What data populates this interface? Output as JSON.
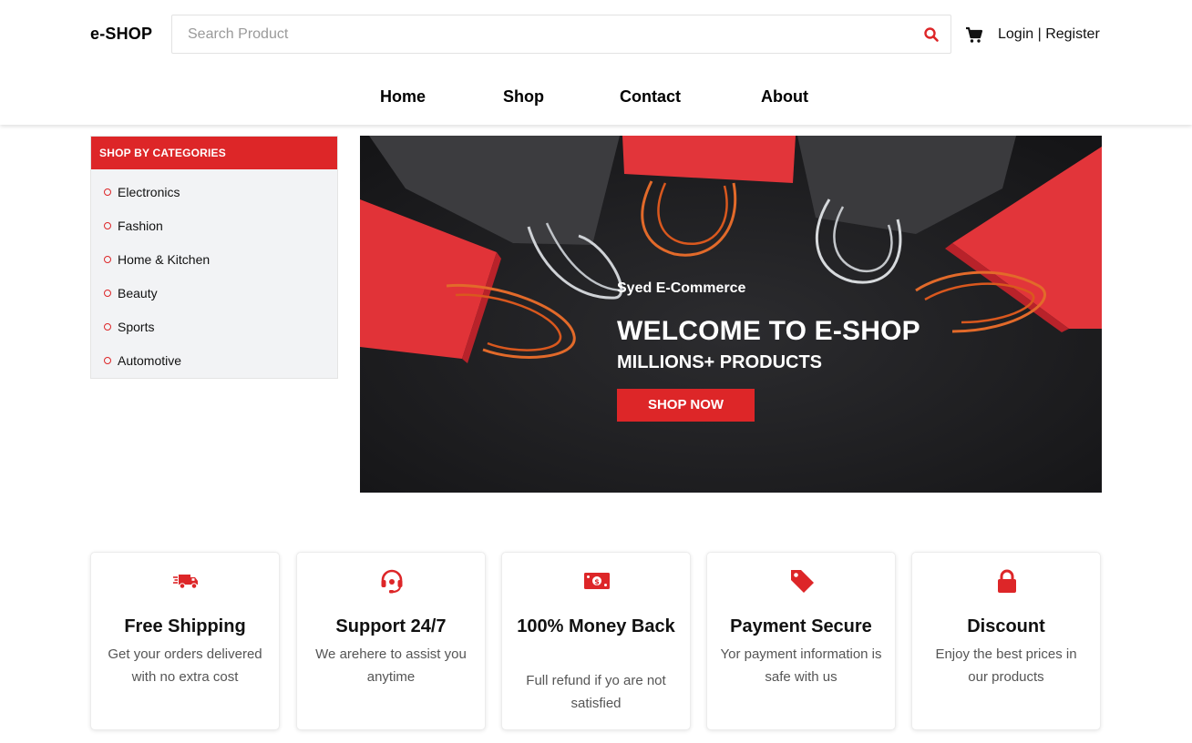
{
  "colors": {
    "accent": "#dd2628",
    "sidebar_bg": "#f2f3f5",
    "hero_bg": "#1c1c1e"
  },
  "header": {
    "logo": "e-SHOP",
    "search": {
      "placeholder": "Search Product",
      "value": "",
      "icon": "search-icon"
    },
    "cart_icon": "cart-icon",
    "login": "Login",
    "separator": " | ",
    "register": "Register"
  },
  "nav": [
    {
      "label": "Home"
    },
    {
      "label": "Shop"
    },
    {
      "label": "Contact"
    },
    {
      "label": "About"
    }
  ],
  "sidebar": {
    "title": "SHOP BY CATEGORIES",
    "items": [
      {
        "label": "Electronics"
      },
      {
        "label": "Fashion"
      },
      {
        "label": "Home & Kitchen"
      },
      {
        "label": "Beauty"
      },
      {
        "label": "Sports"
      },
      {
        "label": "Automotive"
      }
    ]
  },
  "hero": {
    "subtitle": "Syed E-Commerce",
    "title": "WELCOME TO E-SHOP",
    "tagline": "MILLIONS+ PRODUCTS",
    "button": "SHOP NOW"
  },
  "features": [
    {
      "icon": "truck-icon",
      "title": "Free Shipping",
      "description": "Get your orders delivered with no extra cost"
    },
    {
      "icon": "headset-icon",
      "title": "Support 24/7",
      "description": "We arehere to assist you anytime"
    },
    {
      "icon": "money-icon",
      "title": "100% Money Back",
      "description": "Full refund if yo are not satisfied"
    },
    {
      "icon": "tag-icon",
      "title": "Payment Secure",
      "description": "Yor payment information is safe with us"
    },
    {
      "icon": "lock-icon",
      "title": "Discount",
      "description": "Enjoy the best prices in our products"
    }
  ]
}
